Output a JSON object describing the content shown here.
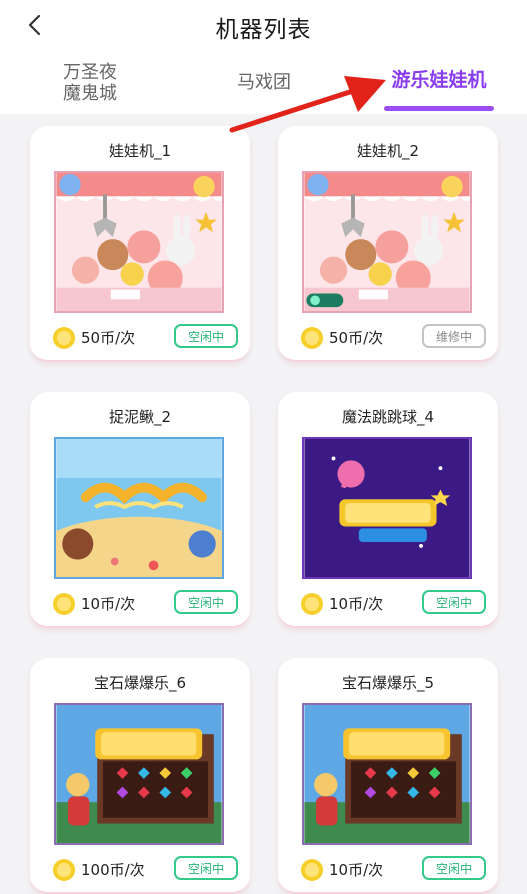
{
  "header": {
    "title": "机器列表",
    "back_icon": "chevron-left-icon"
  },
  "tabs": [
    {
      "label_line1": "万圣夜",
      "label_line2": "魔鬼城",
      "active": false
    },
    {
      "label": "马戏团",
      "active": false
    },
    {
      "label": "游乐娃娃机",
      "active": true
    }
  ],
  "colors": {
    "accent": "#9b4df5",
    "idle": "#33c98b",
    "repair": "#c4c4c4",
    "arrow": "#e2231a"
  },
  "machines": [
    {
      "name": "娃娃机_1",
      "price": "50币/次",
      "status": "空闲中",
      "art": "claw-machine"
    },
    {
      "name": "娃娃机_2",
      "price": "50币/次",
      "status": "维修中",
      "art": "claw-machine"
    },
    {
      "name": "捉泥鳅_2",
      "price": "10币/次",
      "status": "空闲中",
      "art": "loach-game"
    },
    {
      "name": "魔法跳跳球_4",
      "price": "10币/次",
      "status": "空闲中",
      "art": "magic-ball-game"
    },
    {
      "name": "宝石爆爆乐_6",
      "price": "100币/次",
      "status": "空闲中",
      "art": "gem-game"
    },
    {
      "name": "宝石爆爆乐_5",
      "price": "10币/次",
      "status": "空闲中",
      "art": "gem-game"
    }
  ]
}
